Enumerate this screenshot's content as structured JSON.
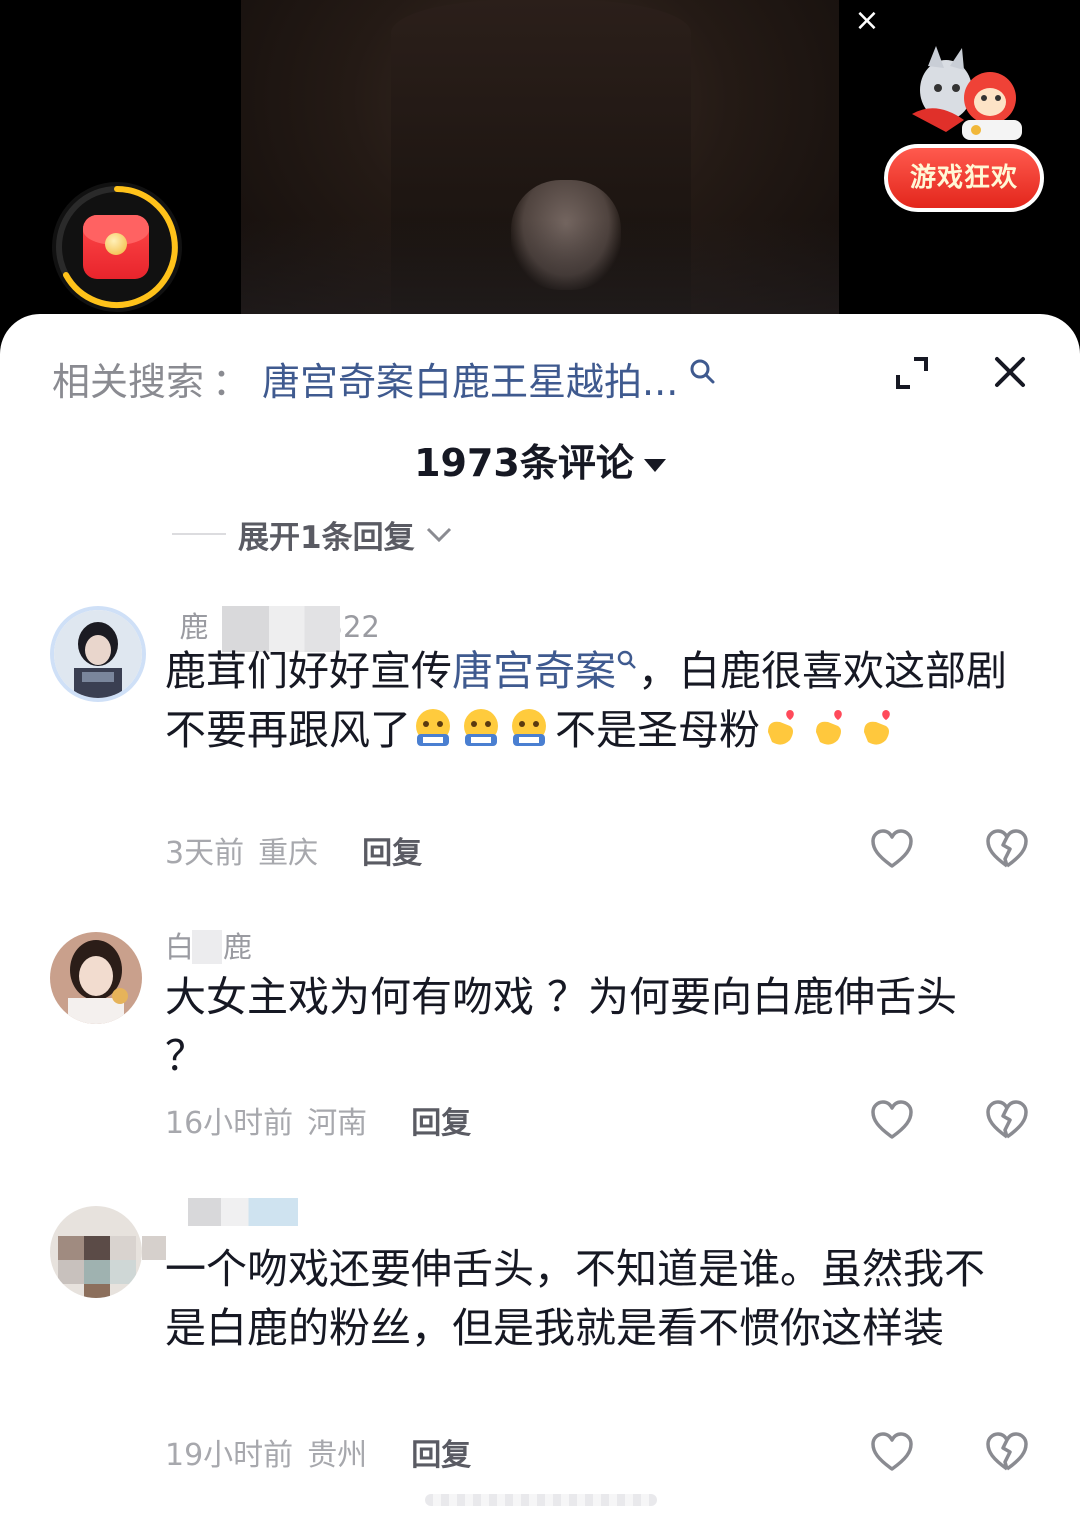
{
  "video": {
    "close_label": "×",
    "game_badge_label": "游戏狂欢"
  },
  "header": {
    "related_label": "相关搜索",
    "separator": "：",
    "related_query": "唐宫奇案白鹿王星越拍...",
    "comment_count_title": "1973条评论"
  },
  "expand_replies": {
    "label": "展开1条回复"
  },
  "comments": [
    {
      "username": " 鹿    522",
      "text_before": "鹿茸们好好宣传",
      "keyword": "唐宫奇案",
      "text_after": "，白鹿很喜欢这部剧不要再跟风了",
      "text_tail": "不是圣母粉",
      "time_location": "3天前 · 重庆",
      "time": "3天前",
      "location": "重庆",
      "reply_label": "回复"
    },
    {
      "username": "白 鹿",
      "text": "大女主戏为何有吻戏 ？为何要向白鹿伸舌头 ？",
      "time": "16小时前",
      "location": "河南",
      "reply_label": "回复"
    },
    {
      "username": "",
      "text": "一个吻戏还要伸舌头，不知道是谁。虽然我不是白鹿的粉丝，但是我就是看不惯你这样装",
      "time": "19小时前",
      "location": "贵州",
      "reply_label": "回复"
    }
  ],
  "colors": {
    "link_blue": "#3f5a8f",
    "text_primary": "#161823",
    "text_secondary": "#a7a8ad",
    "game_red": "#e3261c"
  }
}
